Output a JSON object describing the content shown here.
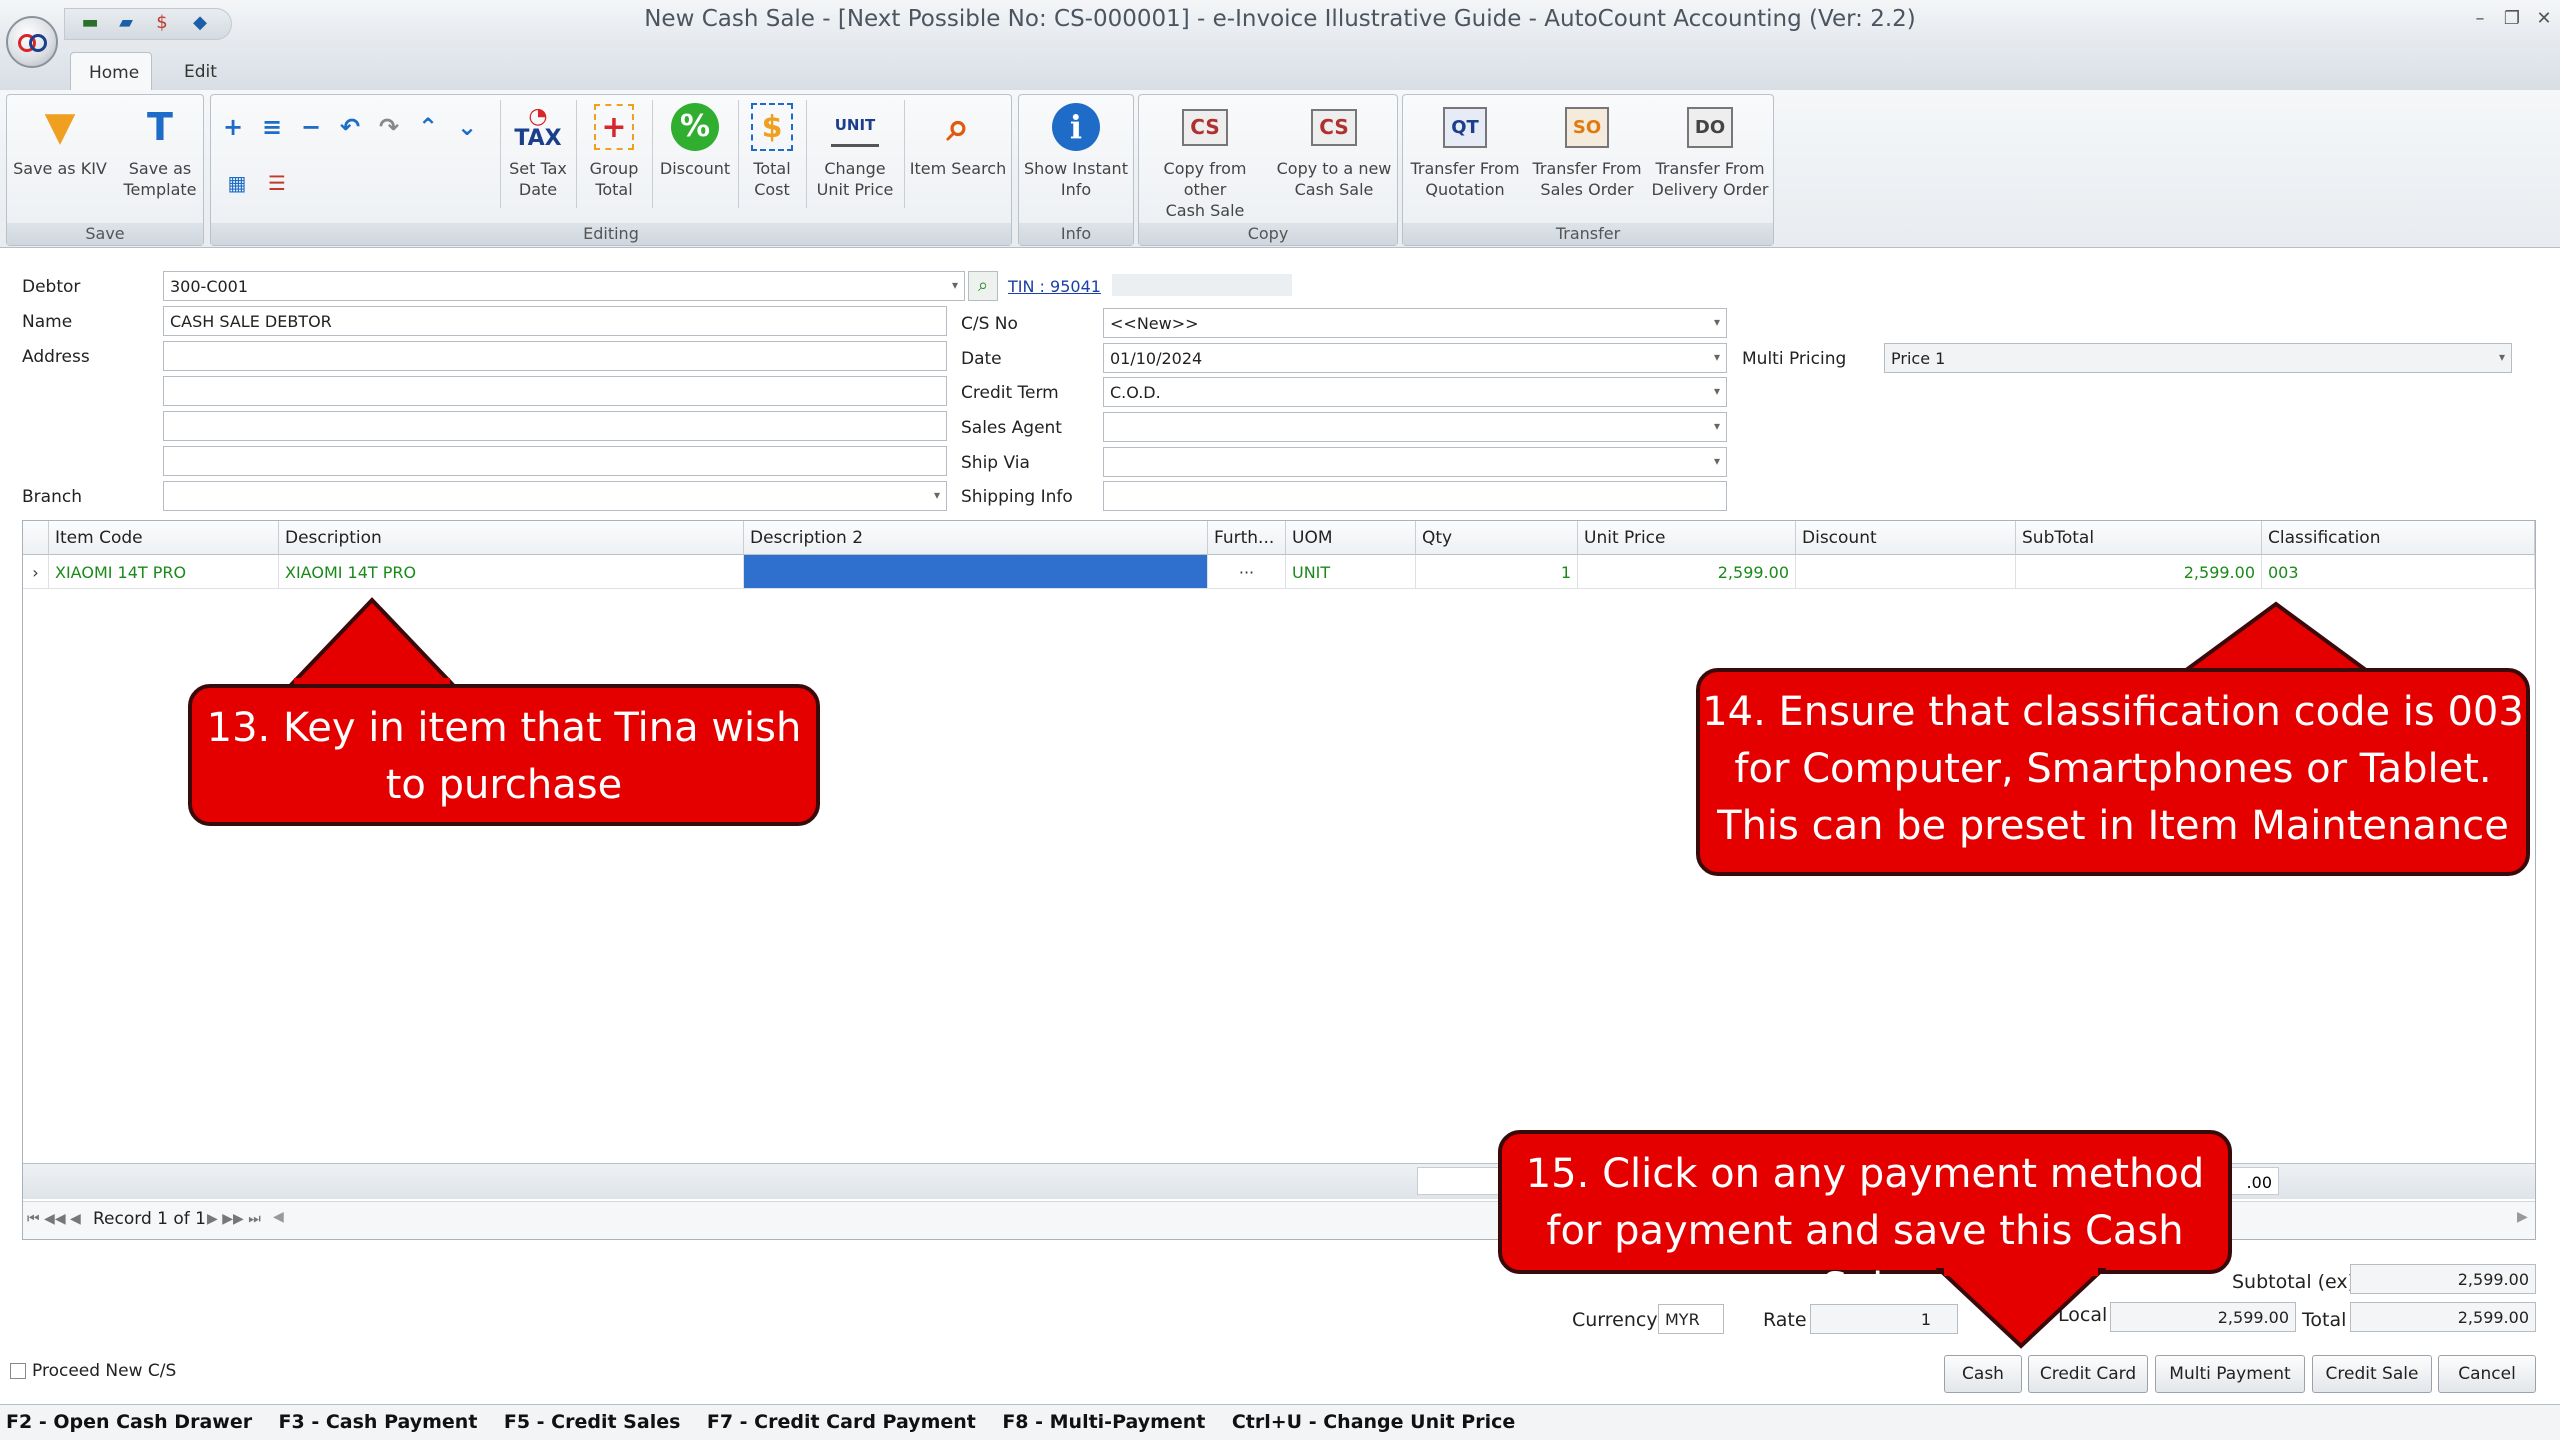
{
  "window": {
    "title": "New Cash Sale - [Next Possible No: CS-000001] - e-Invoice Illustrative Guide - AutoCount Accounting (Ver: 2.2)"
  },
  "tabs": [
    "Home",
    "Edit"
  ],
  "ribbon": {
    "groups": {
      "save": "Save",
      "editing": "Editing",
      "info": "Info",
      "copy": "Copy",
      "transfer": "Transfer"
    },
    "buttons": {
      "save_kiv": "Save as KIV",
      "save_template_1": "Save as",
      "save_template_2": "Template",
      "set_tax_1": "Set Tax",
      "set_tax_2": "Date",
      "group_total_1": "Group",
      "group_total_2": "Total",
      "discount": "Discount",
      "total_cost_1": "Total",
      "total_cost_2": "Cost",
      "change_price_1": "Change",
      "change_price_2": "Unit Price",
      "item_search": "Item Search",
      "show_info_1": "Show Instant",
      "show_info_2": "Info",
      "copy_from_1": "Copy from other",
      "copy_from_2": "Cash Sale",
      "copy_to_1": "Copy to a new",
      "copy_to_2": "Cash Sale",
      "tf_quotation_1": "Transfer From",
      "tf_quotation_2": "Quotation",
      "tf_so_1": "Transfer From",
      "tf_so_2": "Sales Order",
      "tf_do_1": "Transfer From",
      "tf_do_2": "Delivery Order"
    },
    "icon_text": {
      "tax": "TAX",
      "unit": "UNIT",
      "qt": "QT",
      "so": "SO",
      "do": "DO",
      "cs": "CS"
    }
  },
  "form": {
    "labels": {
      "debtor": "Debtor",
      "name": "Name",
      "address": "Address",
      "branch": "Branch",
      "cs_no": "C/S No",
      "date": "Date",
      "credit_term": "Credit Term",
      "sales_agent": "Sales Agent",
      "ship_via": "Ship Via",
      "shipping_info": "Shipping Info",
      "multi_pricing": "Multi Pricing"
    },
    "values": {
      "debtor": "300-C001",
      "tin": "TIN : 95041",
      "name": "CASH SALE DEBTOR",
      "cs_no": "<<New>>",
      "date": "01/10/2024",
      "credit_term": "C.O.D.",
      "multi_pricing": "Price 1"
    }
  },
  "grid": {
    "headers": [
      "Item Code",
      "Description",
      "Description 2",
      "Furth...",
      "UOM",
      "Qty",
      "Unit Price",
      "Discount",
      "SubTotal",
      "Classification"
    ],
    "row": {
      "item_code": "XIAOMI 14T PRO",
      "description": "XIAOMI 14T PRO",
      "description2": "",
      "further": "···",
      "uom": "UNIT",
      "qty": "1",
      "unit_price": "2,599.00",
      "discount": "",
      "subtotal": "2,599.00",
      "classification": "003"
    },
    "footer_partial": ".00",
    "navigator": "Record 1 of 1"
  },
  "totals": {
    "subtotal_label": "Subtotal (ex)",
    "subtotal": "2,599.00",
    "currency_label": "Currency",
    "currency": "MYR",
    "rate_label": "Rate",
    "rate": "1",
    "local_label": "Local",
    "local": "2,599.00",
    "total_label": "Total",
    "total": "2,599.00"
  },
  "proceed_new": "Proceed New C/S",
  "buttons": {
    "cash": "Cash",
    "credit_card": "Credit Card",
    "multi_payment": "Multi Payment",
    "credit_sale": "Credit Sale",
    "cancel": "Cancel"
  },
  "shortcuts": "F2 - Open Cash Drawer    F3 - Cash Payment    F5 - Credit Sales    F7 - Credit Card Payment    F8 - Multi-Payment    Ctrl+U - Change Unit Price",
  "callouts": {
    "c13": "13. Key in item that Tina wish to purchase",
    "c14_line1": "14. Ensure that classification code is 003",
    "c14_line2": "for Computer, Smartphones or Tablet.",
    "c14_line3": "This can be preset in Item Maintenance",
    "c15_line1": "15. Click on any payment method",
    "c15_line2": "for payment and save this Cash Sale"
  },
  "colors": {
    "callout": "#e50000",
    "selected_cell": "#2f6fce",
    "item_text": "#1a8a1a"
  }
}
